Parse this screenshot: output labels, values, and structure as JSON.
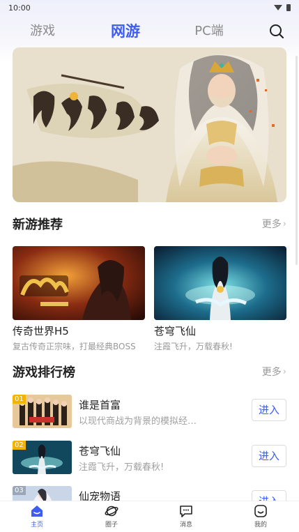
{
  "status_bar": {
    "time": "10:00"
  },
  "tabs": [
    {
      "label": "游戏",
      "active": false
    },
    {
      "label": "网游",
      "active": true
    },
    {
      "label": "PC端",
      "active": false
    }
  ],
  "colors": {
    "accent": "#3d5cf0",
    "muted": "#999999",
    "rank_gold": "#f2b400"
  },
  "banner": {
    "icon": "game-banner-image"
  },
  "new_games": {
    "title": "新游推荐",
    "more": "更多",
    "items": [
      {
        "title": "传奇世界H5",
        "desc": "复古传奇正宗味，打最经典BOSS"
      },
      {
        "title": "苍穹飞仙",
        "desc": "注霞飞升，万载春秋!"
      }
    ]
  },
  "ranking": {
    "title": "游戏排行榜",
    "more": "更多",
    "enter_label": "进入",
    "items": [
      {
        "rank": "01",
        "name": "谁是首富",
        "desc": "以现代商战为背景的模拟经营游戏"
      },
      {
        "rank": "02",
        "name": "苍穹飞仙",
        "desc": "注霞飞升，万载春秋!"
      },
      {
        "rank": "03",
        "name": "仙宠物语",
        "desc": ""
      }
    ]
  },
  "bottom_nav": [
    {
      "label": "主页",
      "icon": "home-icon",
      "active": true
    },
    {
      "label": "圈子",
      "icon": "planet-icon",
      "active": false
    },
    {
      "label": "消息",
      "icon": "message-icon",
      "active": false
    },
    {
      "label": "我的",
      "icon": "profile-icon",
      "active": false
    }
  ]
}
